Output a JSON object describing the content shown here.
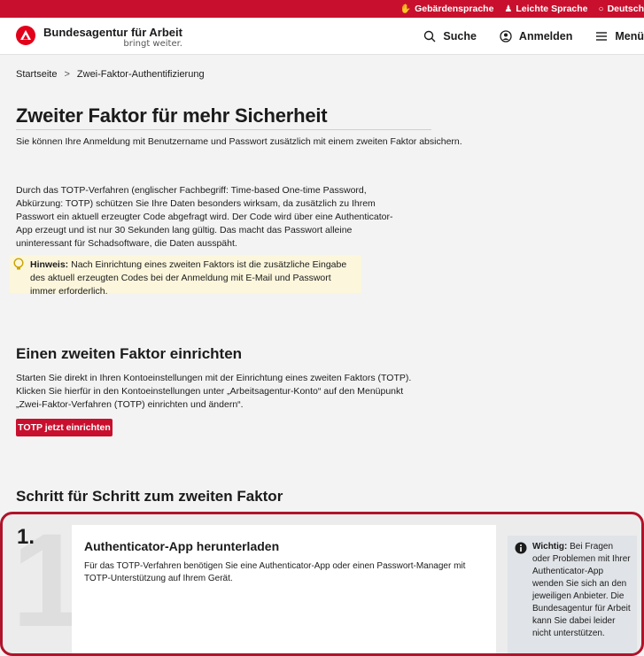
{
  "topbar": {
    "links": [
      {
        "icon": "sign-language-icon",
        "glyph": "✋",
        "label": "Gebärdensprache"
      },
      {
        "icon": "easy-language-icon",
        "glyph": "♟",
        "label": "Leichte Sprache"
      },
      {
        "icon": "globe-icon",
        "glyph": "○",
        "label": "Deutsch"
      }
    ]
  },
  "header": {
    "logo_name": "Bundesagentur für Arbeit",
    "logo_claim": "bringt weiter.",
    "search_label": "Suche",
    "login_label": "Anmelden",
    "menu_label": "Menü"
  },
  "breadcrumb": {
    "home": "Startseite",
    "separator": ">",
    "current": "Zwei-Faktor-Authentifizierung"
  },
  "main": {
    "title": "Zweiter Faktor für mehr Sicherheit",
    "lead": "Sie können Ihre Anmeldung mit Benutzername und Passwort zusätzlich mit einem zweiten Faktor absichern.",
    "paragraph": "Durch das TOTP-Verfahren (englischer Fachbegriff: Time-based One-time Password, Abkürzung: TOTP) schützen Sie Ihre Daten besonders wirksam, da zusätzlich zu Ihrem Passwort ein aktuell erzeugter Code abgefragt wird. Der Code wird über eine Authenticator-App erzeugt und ist nur 30 Sekunden lang gültig. Das macht das Passwort alleine uninteressant für Schadsoftware, die Daten ausspäht.",
    "hint_label": "Hinweis:",
    "hint_text": " Nach Einrichtung eines zweiten Faktors ist die zusätzliche Eingabe des aktuell erzeugten Codes bei der Anmeldung mit E-Mail und Passwort immer erforderlich."
  },
  "setup": {
    "title": "Einen zweiten Faktor einrichten",
    "text": "Starten Sie direkt in Ihren Kontoeinstellungen mit der Einrichtung eines zweiten Faktors (TOTP). Klicken Sie hierfür in den Kontoeinstellungen unter „Arbeitsagentur-Konto“ auf den Menüpunkt „Zwei-Faktor-Verfahren (TOTP) einrichten und ändern“.",
    "button_label": "TOTP jetzt einrichten"
  },
  "steps": {
    "title": "Schritt für Schritt zum zweiten Faktor",
    "items": [
      {
        "number": "1.",
        "ghost": "1",
        "title": "Authenticator-App herunterladen",
        "text": "Für das TOTP-Verfahren benötigen Sie eine Authenticator-App oder einen Passwort-Manager mit TOTP-Unterstützung auf Ihrem Gerät.",
        "info_label": "Wichtig:",
        "info_text": " Bei Fragen oder Problemen mit Ihrer Authenticator-App wenden Sie sich an den jeweiligen Anbieter. Die Bundesagentur für Arbeit kann Sie dabei leider nicht unterstützen."
      }
    ]
  },
  "colors": {
    "brand_red": "#c8102e",
    "hint_bg": "#fbf6dc",
    "info_bg": "#e0e3e7"
  }
}
